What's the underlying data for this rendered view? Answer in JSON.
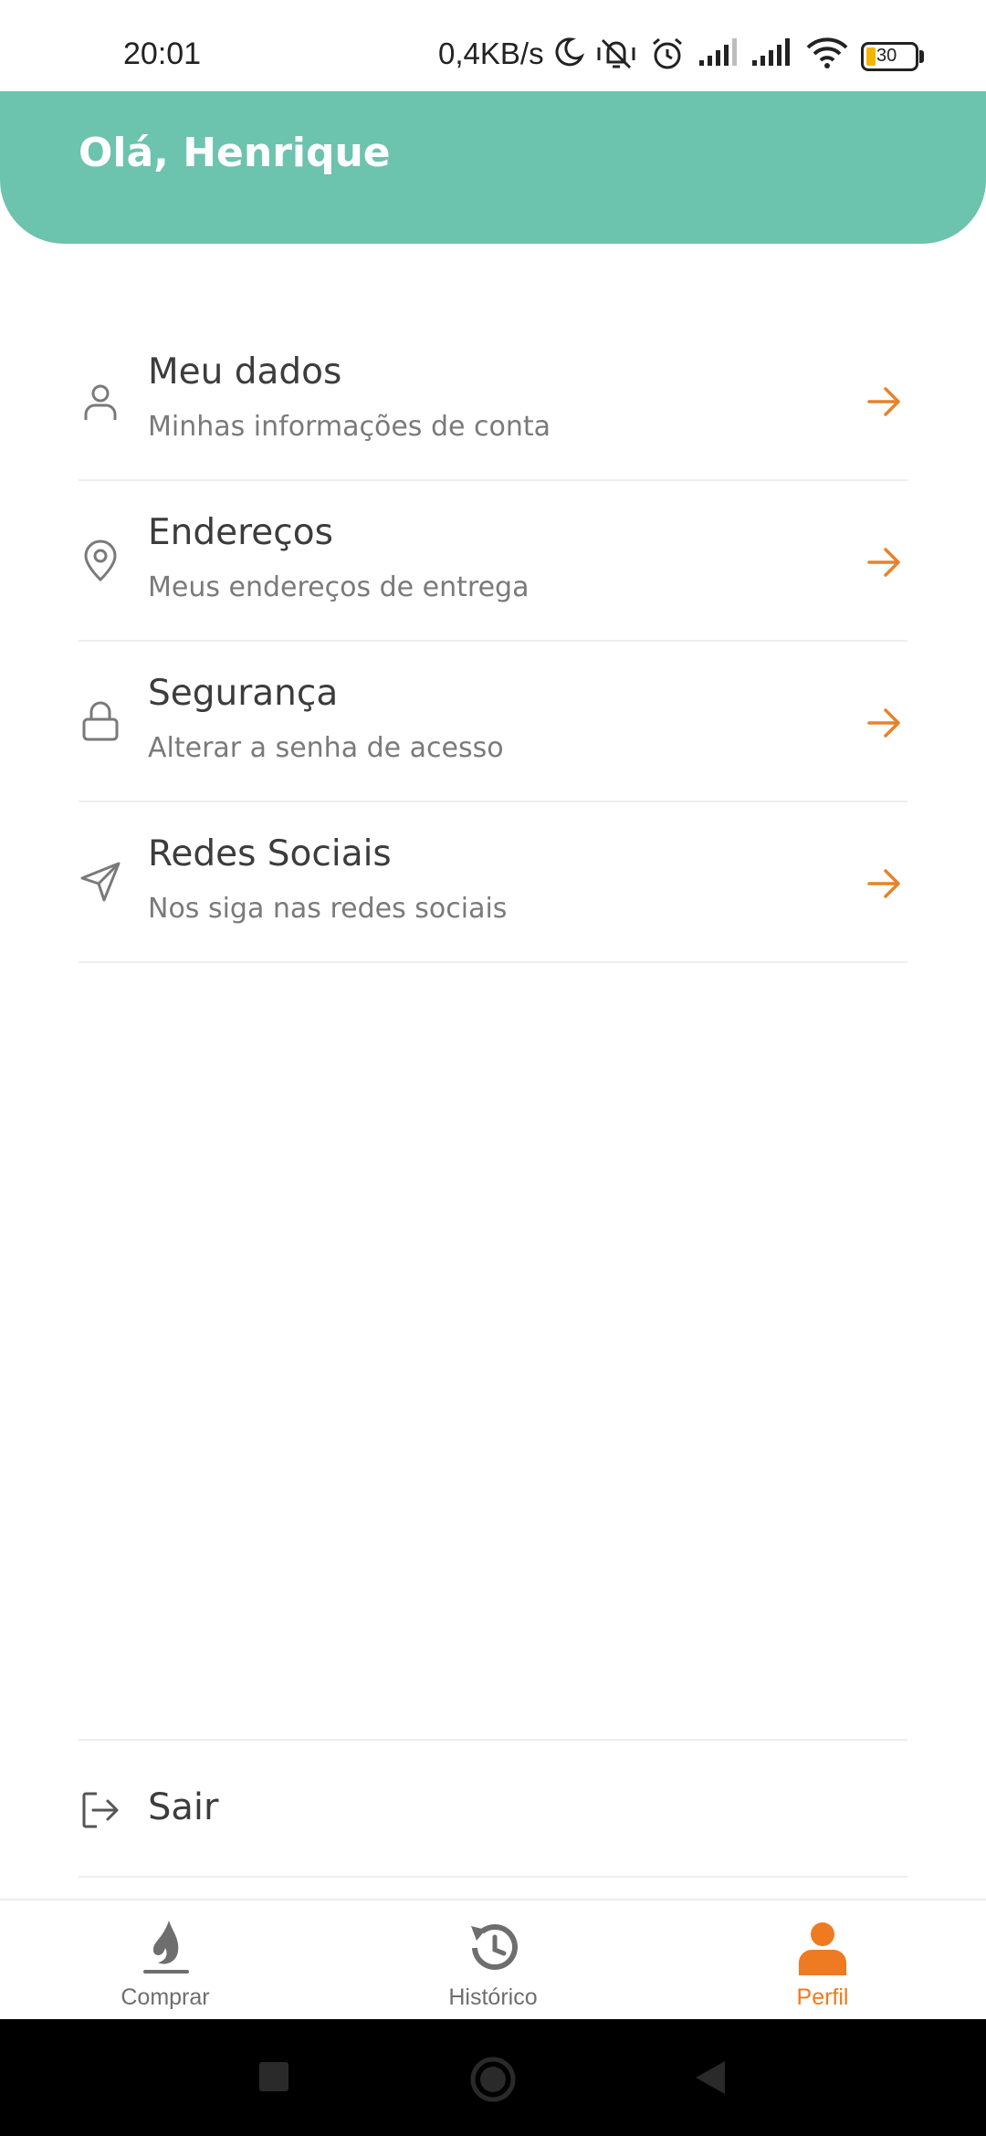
{
  "status_bar": {
    "time": "20:01",
    "network_speed": "0,4KB/s",
    "battery_level": "30",
    "icons": [
      "moon-icon",
      "mute-vibrate-icon",
      "alarm-icon",
      "signal-icon",
      "signal-icon",
      "wifi-icon",
      "battery-icon"
    ]
  },
  "header": {
    "greeting": "Olá, Henrique",
    "background_color": "#6cc3ae"
  },
  "menu": {
    "items": [
      {
        "title": "Meu dados",
        "subtitle": "Minhas informações de conta",
        "icon": "user-icon"
      },
      {
        "title": "Endereços",
        "subtitle": "Meus endereços de entrega",
        "icon": "location-pin-icon"
      },
      {
        "title": "Segurança",
        "subtitle": "Alterar a senha de acesso",
        "icon": "lock-icon"
      },
      {
        "title": "Redes Sociais",
        "subtitle": "Nos siga nas redes sociais",
        "icon": "send-icon"
      }
    ],
    "arrow_color": "#e8822a"
  },
  "logout": {
    "label": "Sair",
    "icon": "logout-icon"
  },
  "bottom_nav": {
    "items": [
      {
        "label": "Comprar",
        "icon": "flame-icon",
        "active": false
      },
      {
        "label": "Histórico",
        "icon": "history-icon",
        "active": false
      },
      {
        "label": "Perfil",
        "icon": "person-icon",
        "active": true
      }
    ],
    "active_color": "#ee7b21",
    "inactive_color": "#6e6e6e"
  },
  "system_nav": {
    "buttons": [
      "recents-icon",
      "home-icon",
      "back-icon"
    ]
  }
}
